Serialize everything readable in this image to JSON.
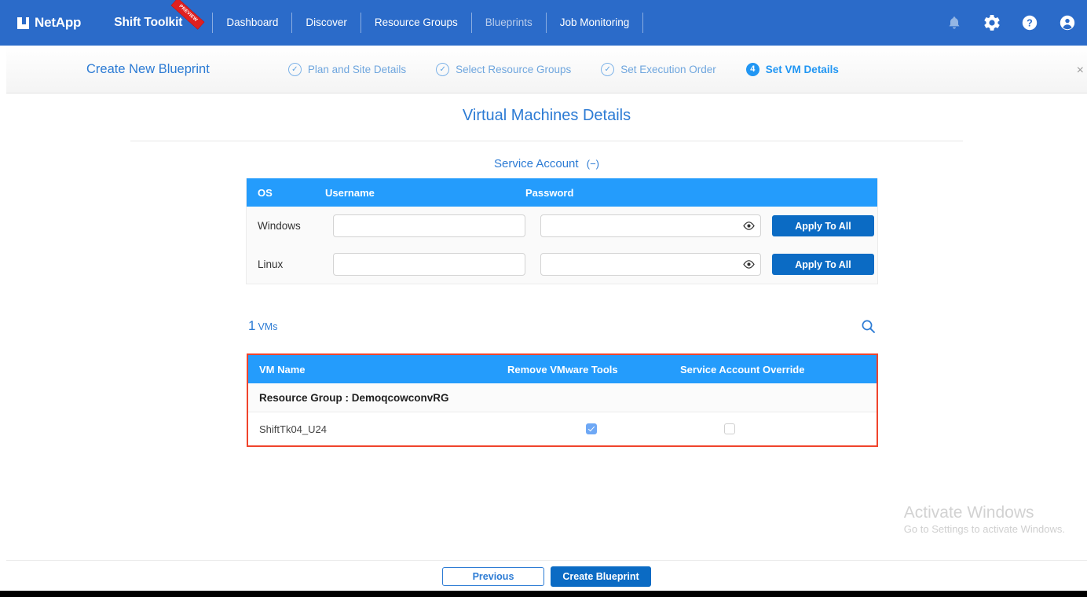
{
  "colors": {
    "header_blue": "#2B6BC9",
    "table_header_blue": "#249CFC",
    "primary_button_blue": "#0B6BC4",
    "link_blue": "#2C7BD4",
    "highlight_red": "#F0442C",
    "checkbox_checked_blue": "#6EA8F5"
  },
  "topbar": {
    "brand": "NetApp",
    "product": "Shift Toolkit",
    "preview_badge": "PREVIEW",
    "nav": [
      {
        "label": "Dashboard",
        "dim": false
      },
      {
        "label": "Discover",
        "dim": false
      },
      {
        "label": "Resource Groups",
        "dim": false
      },
      {
        "label": "Blueprints",
        "dim": true
      },
      {
        "label": "Job Monitoring",
        "dim": false
      }
    ],
    "icons": [
      {
        "name": "bell-icon"
      },
      {
        "name": "gear-icon"
      },
      {
        "name": "help-icon"
      },
      {
        "name": "account-icon"
      }
    ]
  },
  "wizard": {
    "title": "Create New Blueprint",
    "close_label": "×",
    "steps": [
      {
        "badge": "✓",
        "label": "Plan and Site Details",
        "state": "complete"
      },
      {
        "badge": "✓",
        "label": "Select Resource Groups",
        "state": "complete"
      },
      {
        "badge": "✓",
        "label": "Set Execution Order",
        "state": "complete"
      },
      {
        "badge": "4",
        "label": "Set VM Details",
        "state": "current"
      }
    ]
  },
  "page": {
    "title": "Virtual Machines Details",
    "section_title": "Service Account",
    "section_collapse_glyph": "(−)"
  },
  "service_account": {
    "columns": [
      "OS",
      "Username",
      "Password"
    ],
    "apply_label": "Apply To All",
    "username_placeholder": "",
    "password_placeholder": "",
    "rows": [
      {
        "os": "Windows",
        "username": "",
        "password": ""
      },
      {
        "os": "Linux",
        "username": "",
        "password": ""
      }
    ]
  },
  "vm_list": {
    "count": "1",
    "count_unit": "VMs",
    "search_icon": "search-icon",
    "columns": [
      "VM Name",
      "Remove VMware Tools",
      "Service Account Override"
    ],
    "group_label": "Resource Group : DemoqcowconvRG",
    "rows": [
      {
        "name": "ShiftTk04_U24",
        "remove_vmware_tools": true,
        "service_account_override": false
      }
    ]
  },
  "watermark": {
    "title": "Activate Windows",
    "subtitle": "Go to Settings to activate Windows."
  },
  "footer": {
    "previous_label": "Previous",
    "create_label": "Create Blueprint"
  }
}
